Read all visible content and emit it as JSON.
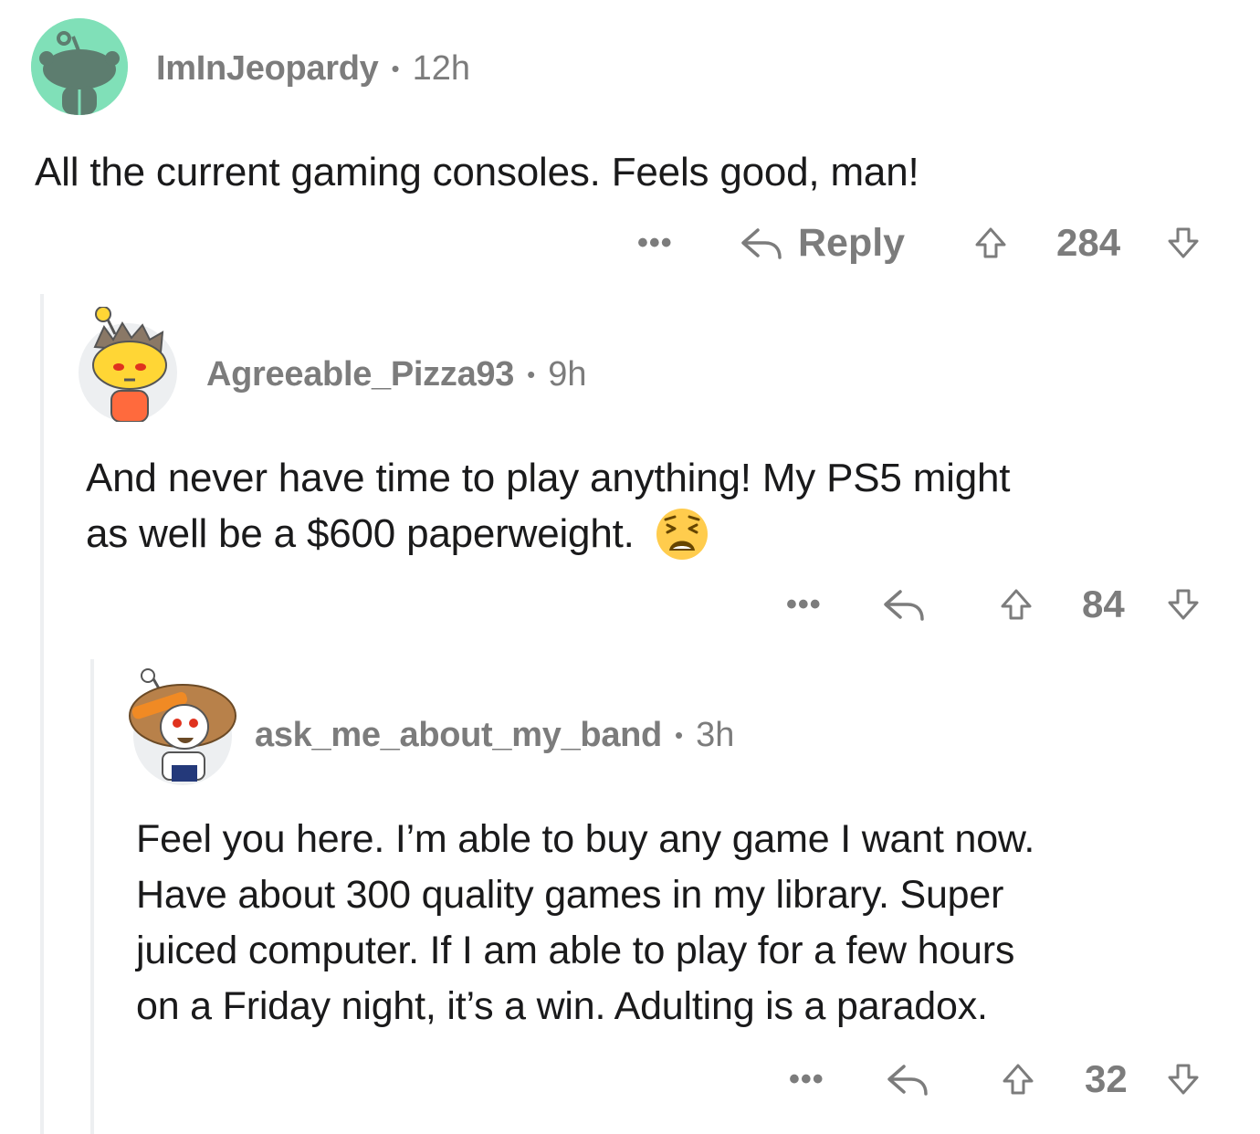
{
  "comments": [
    {
      "username": "ImInJeopardy",
      "separator": "•",
      "time": "12h",
      "text": "All the current gaming consoles. Feels good, man!",
      "more_label": "•••",
      "reply_label": "Reply",
      "score": "284",
      "avatar_color": "#80e0b8"
    },
    {
      "username": "Agreeable_Pizza93",
      "separator": "•",
      "time": "9h",
      "text_lines": [
        "And never have time to play anything! My PS5 might",
        "as well be a $600 paperweight."
      ],
      "emoji": "😩",
      "more_label": "•••",
      "score": "84"
    },
    {
      "username": "ask_me_about_my_band",
      "separator": "•",
      "time": "3h",
      "text_lines": [
        "Feel you here. I’m able to buy any game I want now.",
        "Have about 300 quality games in my library. Super",
        "juiced computer. If I am able to play for a few hours",
        "on a Friday night, it’s a win. Adulting is a paradox."
      ],
      "more_label": "•••",
      "score": "32"
    }
  ],
  "colors": {
    "meta_gray": "#7c7c7c",
    "text": "#1a1a1b",
    "thread_line": "#edeff1"
  }
}
